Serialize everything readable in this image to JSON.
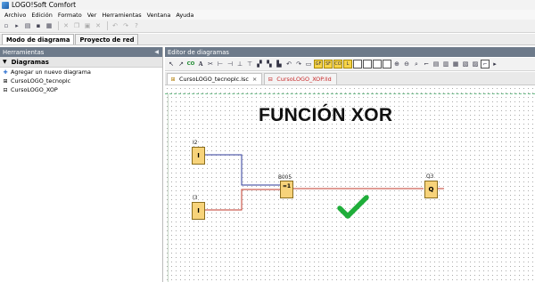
{
  "window": {
    "title": "LOGO!Soft Comfort"
  },
  "menu": [
    "Archivo",
    "Edición",
    "Formato",
    "Ver",
    "Herramientas",
    "Ventana",
    "Ayuda"
  ],
  "mode_tabs": [
    "Modo de diagrama",
    "Proyecto de red"
  ],
  "left_panel": {
    "header": "Herramientas",
    "section": "Diagramas",
    "items": [
      "Agregar un nuevo diagrama",
      "CursoLOGO_tecnoplc",
      "CursoLOGO_XOP"
    ]
  },
  "editor": {
    "header": "Editor de diagramas",
    "tabs": [
      {
        "label": "CursoLOGO_tecnoplc.lsc",
        "close": "×"
      },
      {
        "label": "CursoLOGO_XOP.lld"
      }
    ]
  },
  "diagram": {
    "title": "FUNCIÓN XOR",
    "input1": {
      "label": "I2",
      "value": "I"
    },
    "input2": {
      "label": "I3",
      "value": "I"
    },
    "gate": {
      "label": "B005",
      "value": "=1"
    },
    "output": {
      "label": "Q3",
      "value": "Q"
    },
    "colors": {
      "wire_top": "#2e3a9a",
      "wire_bottom": "#c0392b",
      "wire_out": "#c0392b",
      "check": "#1fae3a",
      "block": "#f7d37a"
    }
  }
}
